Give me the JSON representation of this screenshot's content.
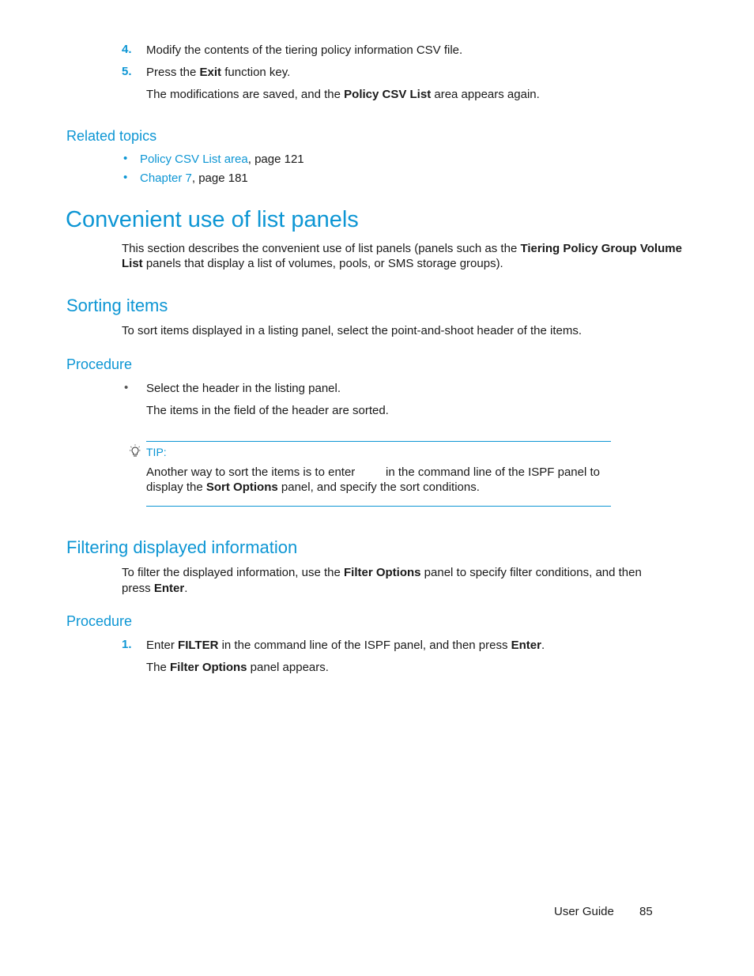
{
  "steps_top": [
    {
      "num": "4.",
      "text": "Modify the contents of the tiering policy information CSV file."
    },
    {
      "num": "5.",
      "pre": "Press the ",
      "bold": "Exit",
      "post": " function key."
    }
  ],
  "step5_result": {
    "pre": "The modifications are saved, and the ",
    "bold": "Policy CSV List",
    "post": " area appears again."
  },
  "related": {
    "heading": "Related topics",
    "items": [
      {
        "link": "Policy CSV List area",
        "suffix": ", page 121"
      },
      {
        "link": "Chapter 7",
        "suffix": ", page 181"
      }
    ]
  },
  "section": {
    "title": "Convenient use of list panels",
    "intro_1_pre": "This section describes the convenient use of list panels (panels such as the ",
    "intro_1_bold": "Tiering Policy Group Volume",
    "intro_2_bold": "List",
    "intro_2_post": " panels that display a list of volumes, pools, or SMS storage groups)."
  },
  "sorting": {
    "title": "Sorting items",
    "text": "To sort items displayed in a listing panel, select the point-and-shoot header of the items.",
    "procedure_heading": "Procedure",
    "bullet": "Select the header in the listing panel.",
    "result": "The items in the field of the header are sorted.",
    "tip": {
      "label": "TIP:",
      "line1_pre": "Another way to sort the items is to enter",
      "line1_post": "in the command line of the ISPF panel to",
      "line2_pre": "display the ",
      "line2_bold": "Sort Options",
      "line2_post": " panel, and specify the sort conditions."
    }
  },
  "filtering": {
    "title": "Filtering displayed information",
    "line1_pre": "To filter the displayed information, use the ",
    "line1_bold": "Filter Options",
    "line1_post": " panel to specify filter conditions, and then",
    "line2_pre": "press ",
    "line2_bold": "Enter",
    "line2_post": ".",
    "procedure_heading": "Procedure",
    "step1": {
      "num": "1.",
      "pre": "Enter ",
      "bold1": "FILTER",
      "mid": " in the command line of the ISPF panel, and then press ",
      "bold2": "Enter",
      "post": "."
    },
    "step1_result": {
      "pre": "The ",
      "bold": "Filter Options",
      "post": " panel appears."
    }
  },
  "footer": {
    "label": "User Guide",
    "page": "85"
  }
}
